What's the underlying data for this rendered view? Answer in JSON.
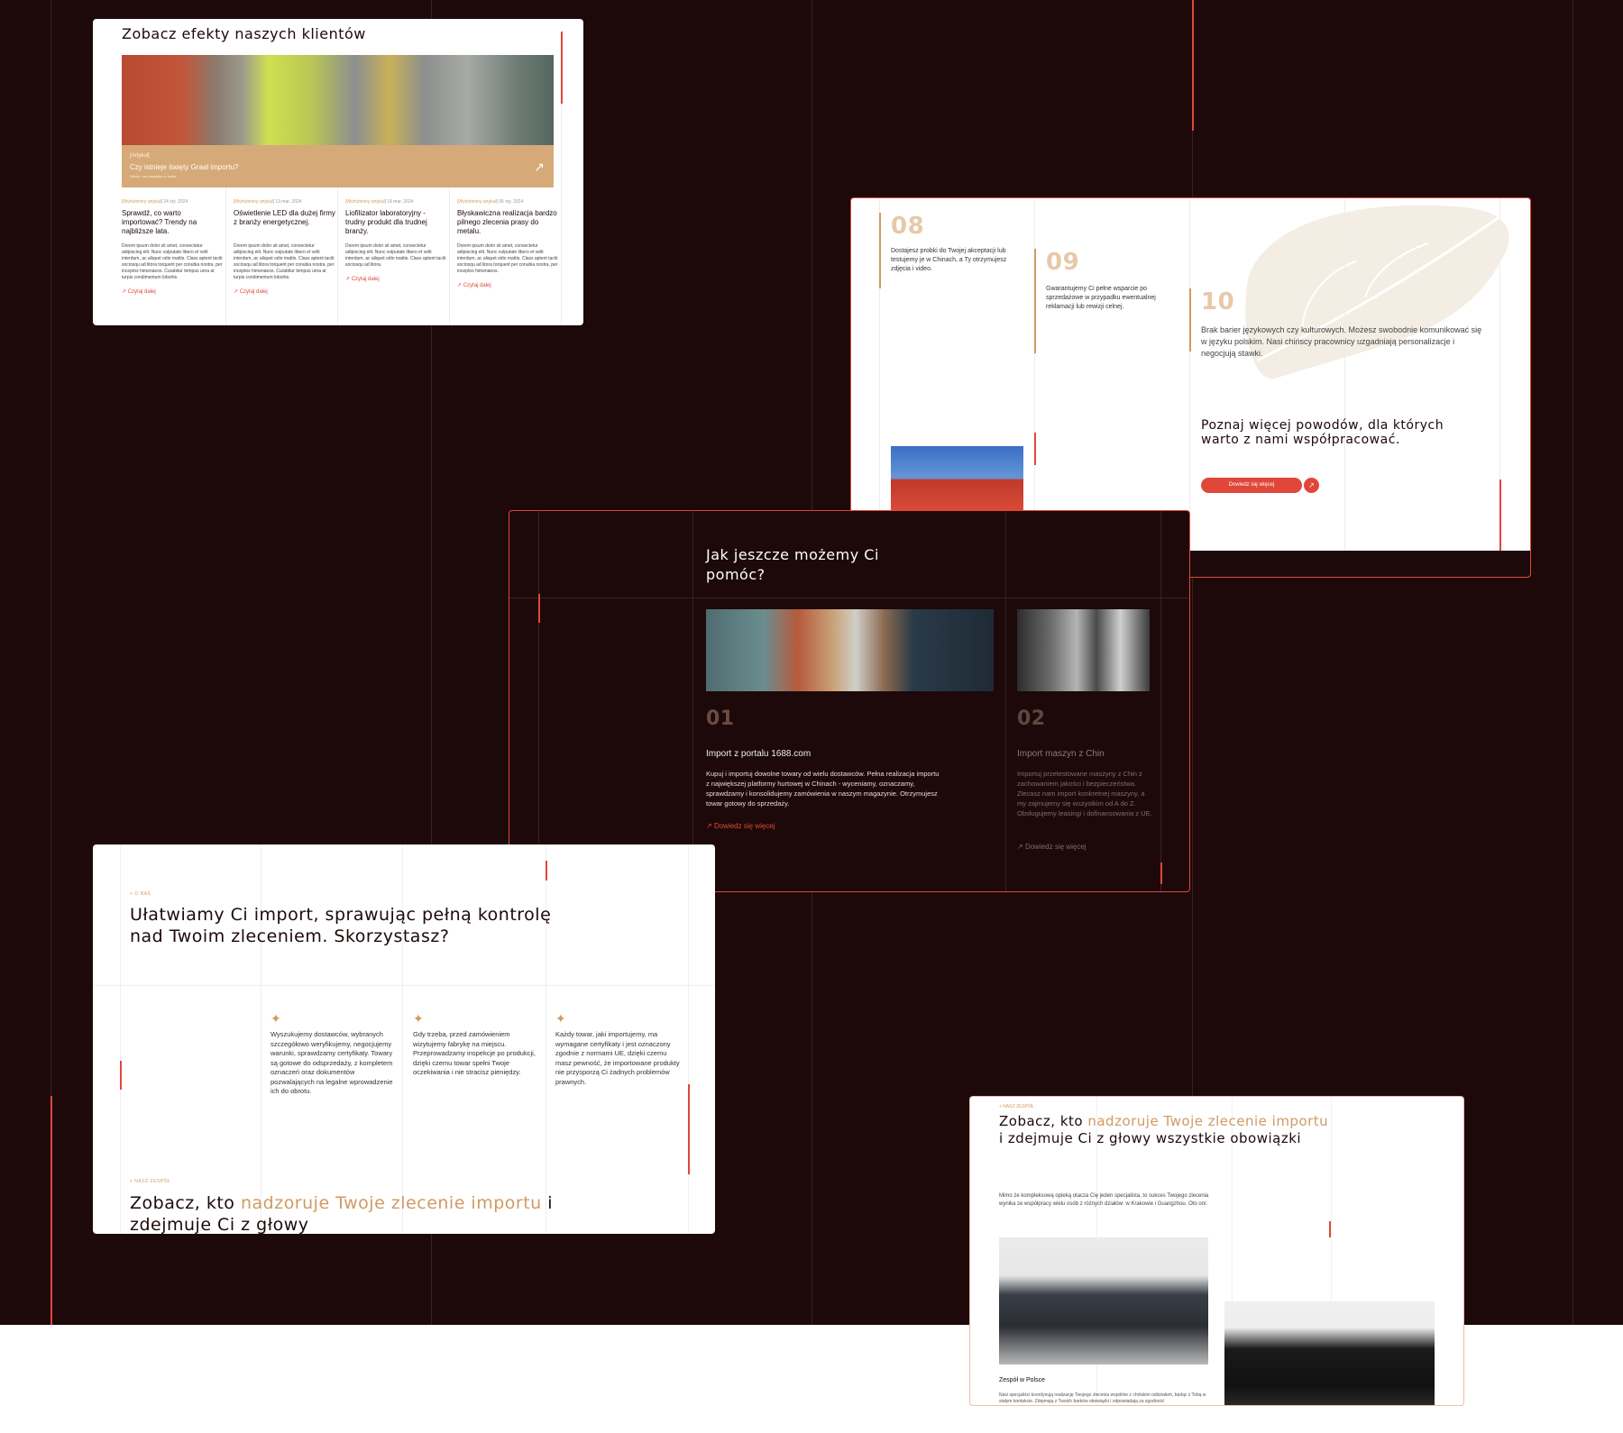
{
  "colors": {
    "bg_dark": "#1d0909",
    "accent_gold": "#d09a63",
    "accent_red": "#e0473a",
    "white": "#ffffff"
  },
  "card_results": {
    "title": "Zobacz efekty naszych klientów",
    "hero": {
      "tag": "[Artykuł]",
      "question": "Czy istnieje święty Graal importu?",
      "subtitle": "Wiedz, czy wszystko w sobie",
      "icon": "arrow-up-right-icon"
    },
    "articles": [
      {
        "category": "[Wyróżniony artykuł]",
        "date": "24 sty. 2024",
        "title": "Sprawdź, co warto importować? Trendy na najbliższe lata.",
        "body": "Dorem ipsum dolor sit amet, consectetur adipiscing elit. Nunc vulputate libero et velit interdum, ac aliquet odio mattis. Class aptent taciti sociosqu ad litora torquent per conubia nostra, per inceptos himenaeos. Curabitur tempus urna at turpis condimentum lobortis.",
        "more": "Czytaj dalej"
      },
      {
        "category": "[Wyróżniony artykuł]",
        "date": "13 mar. 2024",
        "title": "Oświetlenie LED dla dużej firmy z branży energetycznej.",
        "body": "Dorem ipsum dolor sit amet, consectetur adipiscing elit. Nunc vulputate libero et velit interdum, ac aliquet odio mattis. Class aptent taciti sociosqu ad litora torquent per conubia nostra, per inceptos himenaeos. Curabitur tempus urna at turpis condimentum lobortis.",
        "more": "Czytaj dalej"
      },
      {
        "category": "[Wyróżniony artykuł]",
        "date": "18 mar. 2024",
        "title": "Liofilizator laboratoryjny - trudny produkt dla trudnej branży.",
        "body": "Dorem ipsum dolor sit amet, consectetur adipiscing elit. Nunc vulputate libero et velit interdum, ac aliquet odio mattis. Class aptent taciti sociosqu ad litora.",
        "more": "Czytaj dalej"
      },
      {
        "category": "[Wyróżniony artykuł]",
        "date": "06 sty. 2024",
        "title": "Błyskawiczna realizacja bardzo pilnego zlecenia prasy do metalu.",
        "body": "Dorem ipsum dolor sit amet, consectetur adipiscing elit. Nunc vulputate libero et velit interdum, ac aliquet odio mattis. Class aptent taciti sociosqu ad litora torquent per conubia nostra, per inceptos himenaeos.",
        "more": "Czytaj dalej"
      }
    ]
  },
  "card_reasons": {
    "items": [
      {
        "num": "08",
        "text": "Dostajesz probki do Twojej akceptacji lub testujemy je w Chinach, a Ty otrzymujesz zdjęcia i video."
      },
      {
        "num": "09",
        "text": "Gwarantujemy Ci pełne wsparcie po sprzedażowe w przypadku ewentualnej reklamacji lub rewizji celnej."
      },
      {
        "num": "10",
        "text": "Brak barier językowych czy kulturowych. Możesz swobodnie komunikować się w języku polskim. Nasi chińscy pracownicy uzgadniają personalizacje i negocjują stawki."
      }
    ],
    "cta_title": "Poznaj więcej powodów, dla których warto z nami współpracować.",
    "cta_button": "Dowiedz się więcej",
    "cta_icon": "arrow-up-right-icon"
  },
  "card_help": {
    "title": "Jak jeszcze możemy Ci pomóc?",
    "services": [
      {
        "num": "01",
        "title": "Import z portalu 1688.com",
        "body": "Kupuj i importuj dowolne towary od wielu dostawców. Pełna realizacja importu z największej platformy hurtowej w Chinach - wyceniamy, oznaczamy, sprawdzamy i konsolidujemy zamówienia w naszym magazynie. Otrzymujesz towar gotowy do sprzedaży.",
        "more": "Dowiedz się więcej"
      },
      {
        "num": "02",
        "title": "Import maszyn z Chin",
        "body": "Importuj przetestowane maszyny z Chin z zachowaniem jakości i bezpieczeństwa. Zlecasz nam import konkretnej maszyny, a my zajmujemy się wszystkim od A do Z. Obsługujemy leasingi i dofinansowania z UE.",
        "more": "Dowiedz się więcej"
      }
    ]
  },
  "card_about": {
    "eyebrow": "+ O NAS",
    "title": "Ułatwiamy Ci import, sprawując pełną kontrolę nad Twoim zleceniem. Skorzystasz?",
    "features": [
      {
        "icon": "sparkle-icon",
        "text": "Wyszukujemy dostawców, wybranych szczegółowo weryfikujemy, negocjujemy warunki, sprawdzamy certyfikaty. Towary są gotowe do odsprzedaży, z kompletem oznaczeń oraz dokumentów pozwalających na legalne wprowadzenie ich do obrotu."
      },
      {
        "icon": "sparkle-icon",
        "text": "Gdy trzeba, przed zamówieniem wizytujemy fabrykę na miejscu. Przeprowadzamy inspekcje po produkcji, dzięki czemu towar spełni Twoje oczekiwania i nie stracisz pieniędzy."
      },
      {
        "icon": "sparkle-icon",
        "text": "Każdy towar, jaki importujemy, ma wymagane certyfikaty i jest oznaczony zgodnie z normami UE, dzięki czemu masz pewność, że importowane produkty nie przysporzą Ci żadnych problemów prawnych."
      }
    ],
    "team_eyebrow": "+ NASZ ZESPÓŁ",
    "team_title_a": "Zobacz, kto ",
    "team_title_hl": "nadzoruje Twoje zlecenie importu",
    "team_title_b": " i zdejmuje Ci z głowy"
  },
  "card_team": {
    "eyebrow": "+ NASZ ZESPÓŁ",
    "title_a": "Zobacz, kto ",
    "title_hl": "nadzoruje Twoje zlecenie importu",
    "title_b": " i zdejmuje Ci z głowy wszystkie obowiązki",
    "intro": "Mimo że kompleksową opieką otacza Cię jeden specjalista, to sukces Twojego zlecenia wynika ze współpracy wielu osób z różnych działów: w Krakowie i Guangzhou. Oto oni:",
    "caption": "Zespół w Polsce",
    "caption_text": "Nasi specjaliści koordynują realizację Twojego zlecenia wspólnie z chińskim oddziałem, będąc z Tobą w stałym kontakcie. Zdejmują z Twoich barków obowiązki i odpowiadają za zgodność"
  }
}
